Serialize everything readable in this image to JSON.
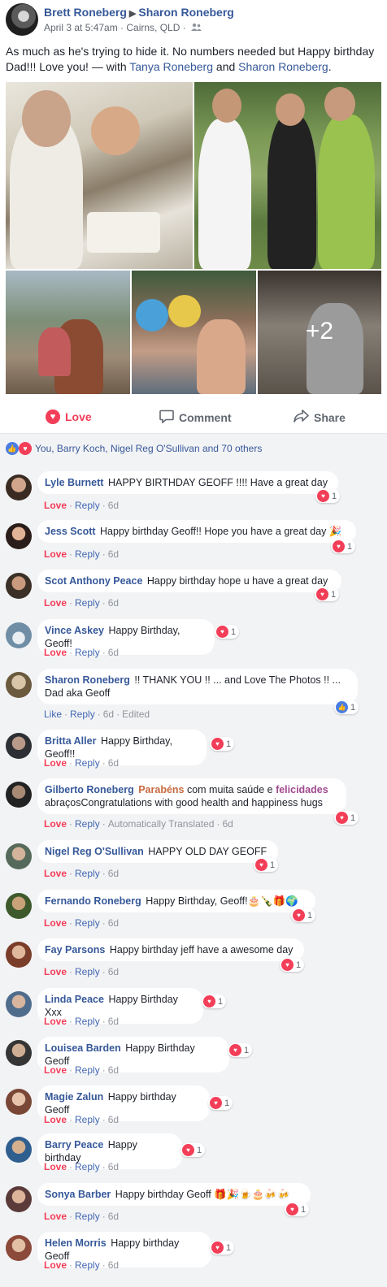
{
  "post": {
    "author": "Brett Roneberg",
    "target": "Sharon Roneberg",
    "arrow": "▶",
    "meta": "April 3 at 5:47am · Cairns, QLD ·",
    "text_main": "As much as he's trying to hide it. No numbers needed but Happy birthday Dad!!! Love you! — with ",
    "tag1": "Tanya Roneberg",
    "tag_and": " and ",
    "tag2": "Sharon Roneberg",
    "tag_end": ".",
    "more_photos": "+2"
  },
  "actions": {
    "love": "Love",
    "comment": "Comment",
    "share": "Share"
  },
  "reactions_summary": "You, Barry Koch, Nigel Reg O'Sullivan and 70 others",
  "icons": {
    "heart": "heart-icon",
    "like": "like-icon",
    "comment": "comment-icon",
    "share": "share-icon",
    "friends": "friends-icon"
  },
  "colors": {
    "love": "#f33e58",
    "link": "#365899",
    "like": "#4a7de3",
    "comments_bg": "#f2f3f5"
  },
  "comments": [
    {
      "author": "Lyle Burnett",
      "text": "HAPPY BIRTHDAY GEOFF !!!! Have a great day",
      "action": "Love",
      "reply": "Reply",
      "time": "6d",
      "count": "1"
    },
    {
      "author": "Jess Scott",
      "text": "Happy birthday Geoff!! Hope you have a great day 🎉",
      "action": "Love",
      "reply": "Reply",
      "time": "6d",
      "count": "1"
    },
    {
      "author": "Scot Anthony Peace",
      "text": "Happy birthday hope u have a great day",
      "action": "Love",
      "reply": "Reply",
      "time": "6d",
      "count": "1"
    },
    {
      "author": "Vince Askey",
      "text": "Happy Birthday, Geoff!",
      "action": "Love",
      "reply": "Reply",
      "time": "6d",
      "count": "1"
    },
    {
      "author": "Sharon Roneberg",
      "text": "!! THANK YOU !! ... and Love The Photos !! ... Dad aka Geoff",
      "action": "Like",
      "reply": "Reply",
      "time": "6d",
      "extra": "Edited",
      "count": "1"
    },
    {
      "author": "Britta Aller",
      "text": "Happy Birthday, Geoff!!",
      "action": "Love",
      "reply": "Reply",
      "time": "6d",
      "count": "1"
    },
    {
      "author": "Gilberto Roneberg",
      "hl1": "Parabéns",
      "text_a": " com muita saúde e ",
      "hl2": "felicidades",
      "text_b": " abraçosCongratulations with good health and happiness hugs",
      "action": "Love",
      "reply": "Reply",
      "extra": "Automatically Translated",
      "time": "6d",
      "count": "1"
    },
    {
      "author": "Nigel Reg O'Sullivan",
      "text": "HAPPY OLD DAY GEOFF",
      "action": "Love",
      "reply": "Reply",
      "time": "6d",
      "count": "1"
    },
    {
      "author": "Fernando Roneberg",
      "text": "Happy Birthday, Geoff!🎂🍾🎁🌍",
      "action": "Love",
      "reply": "Reply",
      "time": "6d",
      "count": "1"
    },
    {
      "author": "Fay Parsons",
      "text": "Happy birthday jeff have a awesome day",
      "action": "Love",
      "reply": "Reply",
      "time": "6d",
      "count": "1"
    },
    {
      "author": "Linda Peace",
      "text": "Happy Birthday Xxx",
      "action": "Love",
      "reply": "Reply",
      "time": "6d",
      "count": "1"
    },
    {
      "author": "Louisea Barden",
      "text": "Happy Birthday Geoff",
      "action": "Love",
      "reply": "Reply",
      "time": "6d",
      "count": "1"
    },
    {
      "author": "Magie Zalun",
      "text": "Happy birthday Geoff",
      "action": "Love",
      "reply": "Reply",
      "time": "6d",
      "count": "1"
    },
    {
      "author": "Barry Peace",
      "text": "Happy birthday",
      "action": "Love",
      "reply": "Reply",
      "time": "6d",
      "count": "1"
    },
    {
      "author": "Sonya Barber",
      "text": "Happy birthday Geoff 🎁🎉🍺🎂🍻🍻",
      "action": "Love",
      "reply": "Reply",
      "time": "6d",
      "count": "1"
    },
    {
      "author": "Helen Morris",
      "text": "Happy birthday Geoff",
      "action": "Love",
      "reply": "Reply",
      "time": "6d",
      "count": "1"
    }
  ]
}
